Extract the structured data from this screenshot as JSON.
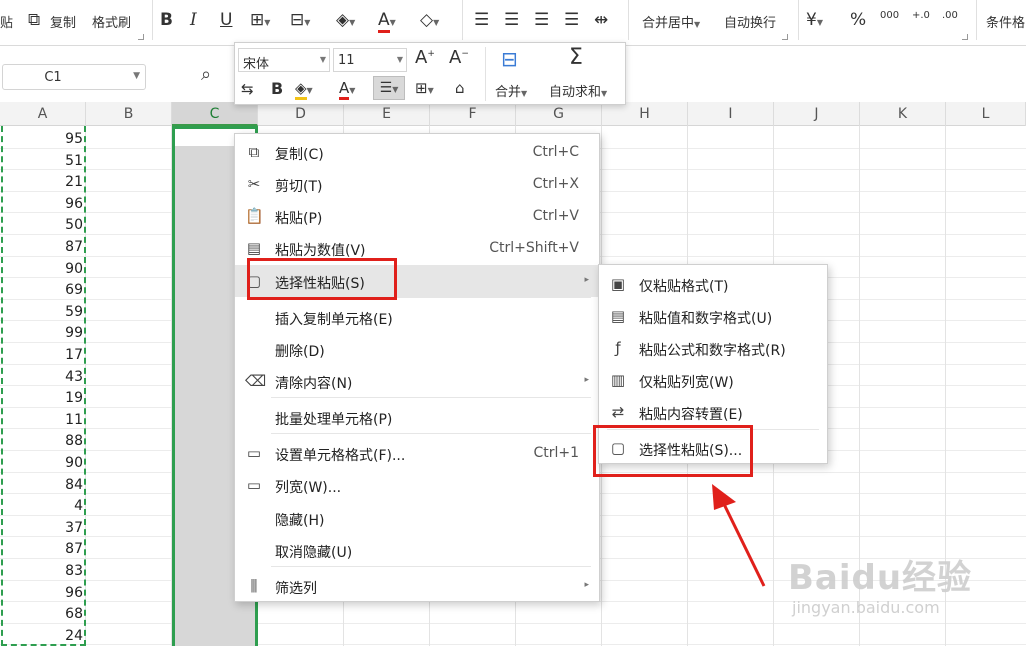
{
  "ribbon": {
    "copy_label": "复制",
    "format_painter_label": "格式刷",
    "merge_center_label": "合并居中",
    "wrap_text_label": "自动换行",
    "percent_symbol": "%",
    "decimal_increase": ".00→.0",
    "conditional_format_label": "条件格"
  },
  "formula_bar": {
    "name_box_value": "C1"
  },
  "mini_toolbar": {
    "font_name": "宋体",
    "font_size": "11",
    "merge_label": "合并",
    "autosum_label": "自动求和"
  },
  "columns": [
    "A",
    "B",
    "C",
    "D",
    "E",
    "F",
    "G",
    "H",
    "I",
    "J",
    "K",
    "L"
  ],
  "selected_column": "C",
  "column_a_values": [
    "95",
    "51",
    "21",
    "96",
    "50",
    "87",
    "90",
    "69",
    "59",
    "99",
    "17",
    "43",
    "19",
    "11",
    "88",
    "90",
    "84",
    "4",
    "37",
    "87",
    "83",
    "96",
    "68",
    "24"
  ],
  "context_menu": {
    "items": [
      {
        "label": "复制(C)",
        "shortcut": "Ctrl+C",
        "icon": "copy-icon"
      },
      {
        "label": "剪切(T)",
        "shortcut": "Ctrl+X",
        "icon": "scissors-icon"
      },
      {
        "label": "粘贴(P)",
        "shortcut": "Ctrl+V",
        "icon": "paste-icon"
      },
      {
        "label": "粘贴为数值(V)",
        "shortcut": "Ctrl+Shift+V",
        "icon": "paste-values-icon"
      },
      {
        "label": "选择性粘贴(S)",
        "shortcut": "",
        "icon": "paste-special-icon",
        "submenu": true,
        "highlighted": true
      },
      {
        "label": "插入复制单元格(E)",
        "shortcut": "",
        "icon": ""
      },
      {
        "label": "删除(D)",
        "shortcut": "",
        "icon": ""
      },
      {
        "label": "清除内容(N)",
        "shortcut": "",
        "icon": "eraser-icon",
        "submenu": true
      },
      {
        "label": "批量处理单元格(P)",
        "shortcut": "",
        "icon": ""
      },
      {
        "label": "设置单元格格式(F)...",
        "shortcut": "Ctrl+1",
        "icon": "format-cells-icon"
      },
      {
        "label": "列宽(W)...",
        "shortcut": "",
        "icon": "column-width-icon"
      },
      {
        "label": "隐藏(H)",
        "shortcut": "",
        "icon": ""
      },
      {
        "label": "取消隐藏(U)",
        "shortcut": "",
        "icon": ""
      },
      {
        "label": "筛选列",
        "shortcut": "",
        "icon": "filter-columns-icon",
        "submenu": true
      }
    ]
  },
  "submenu": {
    "items": [
      {
        "label": "仅粘贴格式(T)",
        "icon": "paste-format-icon"
      },
      {
        "label": "粘贴值和数字格式(U)",
        "icon": "paste-values-number-format-icon"
      },
      {
        "label": "粘贴公式和数字格式(R)",
        "icon": "paste-formula-icon"
      },
      {
        "label": "仅粘贴列宽(W)",
        "icon": "paste-column-width-icon"
      },
      {
        "label": "粘贴内容转置(E)",
        "icon": "paste-transpose-icon"
      },
      {
        "label": "选择性粘贴(S)...",
        "icon": "paste-special-icon"
      }
    ]
  },
  "watermark": {
    "brand": "Baidu经验",
    "url": "jingyan.baidu.com"
  },
  "colors": {
    "selection_green": "#2e9e4f",
    "annotation_red": "#e0201b",
    "menu_highlight": "#e6e6e6"
  }
}
